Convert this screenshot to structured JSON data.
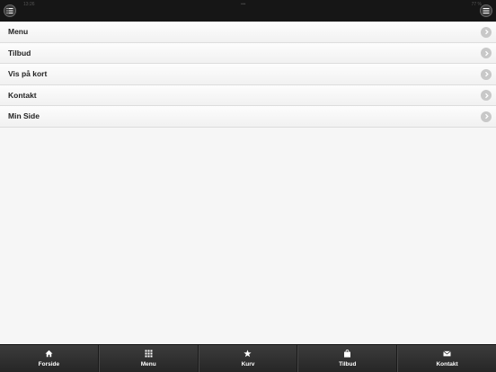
{
  "statusbar": {
    "time": "13:26",
    "center": "•••",
    "battery": "77 %"
  },
  "topbar": {
    "left_icon": "list-icon",
    "right_icon": "menu-icon"
  },
  "menu_list": {
    "items": [
      {
        "label": "Menu"
      },
      {
        "label": "Tilbud"
      },
      {
        "label": "Vis på kort"
      },
      {
        "label": "Kontakt"
      },
      {
        "label": "Min Side"
      }
    ]
  },
  "tabbar": {
    "tabs": [
      {
        "label": "Forside",
        "icon": "home-icon"
      },
      {
        "label": "Menu",
        "icon": "grid-icon"
      },
      {
        "label": "Kurv",
        "icon": "star-icon"
      },
      {
        "label": "Tilbud",
        "icon": "bag-icon"
      },
      {
        "label": "Kontakt",
        "icon": "mail-icon"
      }
    ]
  },
  "colors": {
    "topbar_bg": "#161616",
    "page_bg": "#f6f6f6",
    "tabbar_bg": "#2f2f2f",
    "chevron_bg": "#c8c8c8"
  }
}
